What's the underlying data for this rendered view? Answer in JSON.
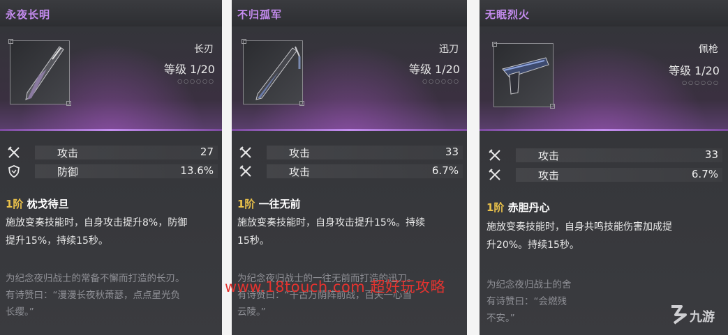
{
  "cards": [
    {
      "title": "永夜长明",
      "weapon_type": "长刃",
      "level": "等级 1/20",
      "stars": "○○○○○○",
      "stats": [
        {
          "icon": "attack-icon",
          "label": "攻击",
          "value": "27"
        },
        {
          "icon": "defense-icon",
          "label": "防御",
          "value": "13.6%"
        }
      ],
      "skill_rank": "1阶",
      "skill_name": "枕戈待旦",
      "skill_desc_lines": [
        "施放变奏技能时，自身攻击提升8%，防御",
        "提升15%，持续15秒。"
      ],
      "lore_lines": [
        "为纪念夜归战士的常备不懈而打造的长刃。",
        "有诗赞曰：“漫漫长夜秋萧瑟，点点星光负",
        "长缨。”"
      ]
    },
    {
      "title": "不归孤军",
      "weapon_type": "迅刀",
      "level": "等级 1/20",
      "stars": "○○○○○○",
      "stats": [
        {
          "icon": "attack-icon",
          "label": "攻击",
          "value": "33"
        },
        {
          "icon": "attack-icon",
          "label": "攻击",
          "value": "6.7%"
        }
      ],
      "skill_rank": "1阶",
      "skill_name": "一往无前",
      "skill_desc_lines": [
        "施放变奏技能时，自身攻击提升15%。持续",
        "15秒。"
      ],
      "lore_lines": [
        "为纪念夜归战士的一往无前而打造的迅刀。",
        "有诗赞曰：“千古万荫阵前战，百夫一心当",
        "云陵。”"
      ]
    },
    {
      "title": "无眠烈火",
      "weapon_type": "佩枪",
      "level": "等级 1/20",
      "stars": "○○○○○○",
      "stats": [
        {
          "icon": "attack-icon",
          "label": "攻击",
          "value": "33"
        },
        {
          "icon": "attack-icon",
          "label": "攻击",
          "value": "6.7%"
        }
      ],
      "skill_rank": "1阶",
      "skill_name": "赤胆丹心",
      "skill_desc_lines": [
        "施放变奏技能时，自身共鸣技能伤害加成提",
        "升20%。持续15秒。"
      ],
      "lore_lines": [
        "为纪念夜归战士的舍",
        "有诗赞曰：“会燃残",
        "不安。”"
      ]
    }
  ],
  "watermark": "www.18touch.com 超好玩攻略",
  "logo_text": "九游",
  "colors": {
    "title": "#c58cf0",
    "rank": "#e9c14a",
    "watermark": "#e5332f"
  }
}
